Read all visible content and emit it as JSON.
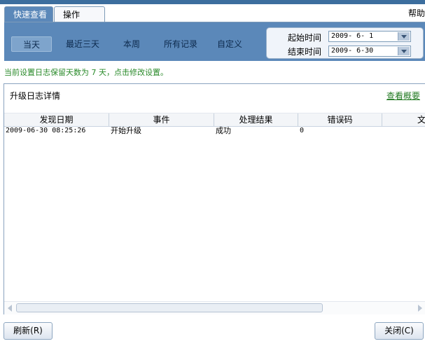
{
  "tabs": [
    {
      "label": "快速查看",
      "active": true
    },
    {
      "label": "操作",
      "active": false
    }
  ],
  "help_label": "帮助",
  "filters": {
    "buttons": [
      {
        "label": "当天",
        "selected": true
      },
      {
        "label": "最近三天",
        "selected": false
      },
      {
        "label": "本周",
        "selected": false
      },
      {
        "label": "所有记录",
        "selected": false
      },
      {
        "label": "自定义",
        "selected": false
      }
    ],
    "start_label": "起始时间",
    "start_value": "2009- 6- 1",
    "end_label": "结束时间",
    "end_value": "2009- 6-30"
  },
  "notice": "当前设置日志保留天数为 7 天，点击修改设置。",
  "panel": {
    "title": "升级日志详情",
    "summary_link": "查看概要",
    "columns": [
      "发现日期",
      "事件",
      "处理结果",
      "错误码",
      "文件"
    ],
    "rows": [
      [
        "2009-06-30 08:25:26",
        "开始升级",
        "成功",
        "0",
        ""
      ]
    ]
  },
  "buttons": {
    "refresh": "刷新(R)",
    "close": "关闭(C)"
  },
  "colors": {
    "accent_blue": "#5b88b9",
    "notice_green": "#2a8a2a",
    "link_green": "#227a22"
  }
}
